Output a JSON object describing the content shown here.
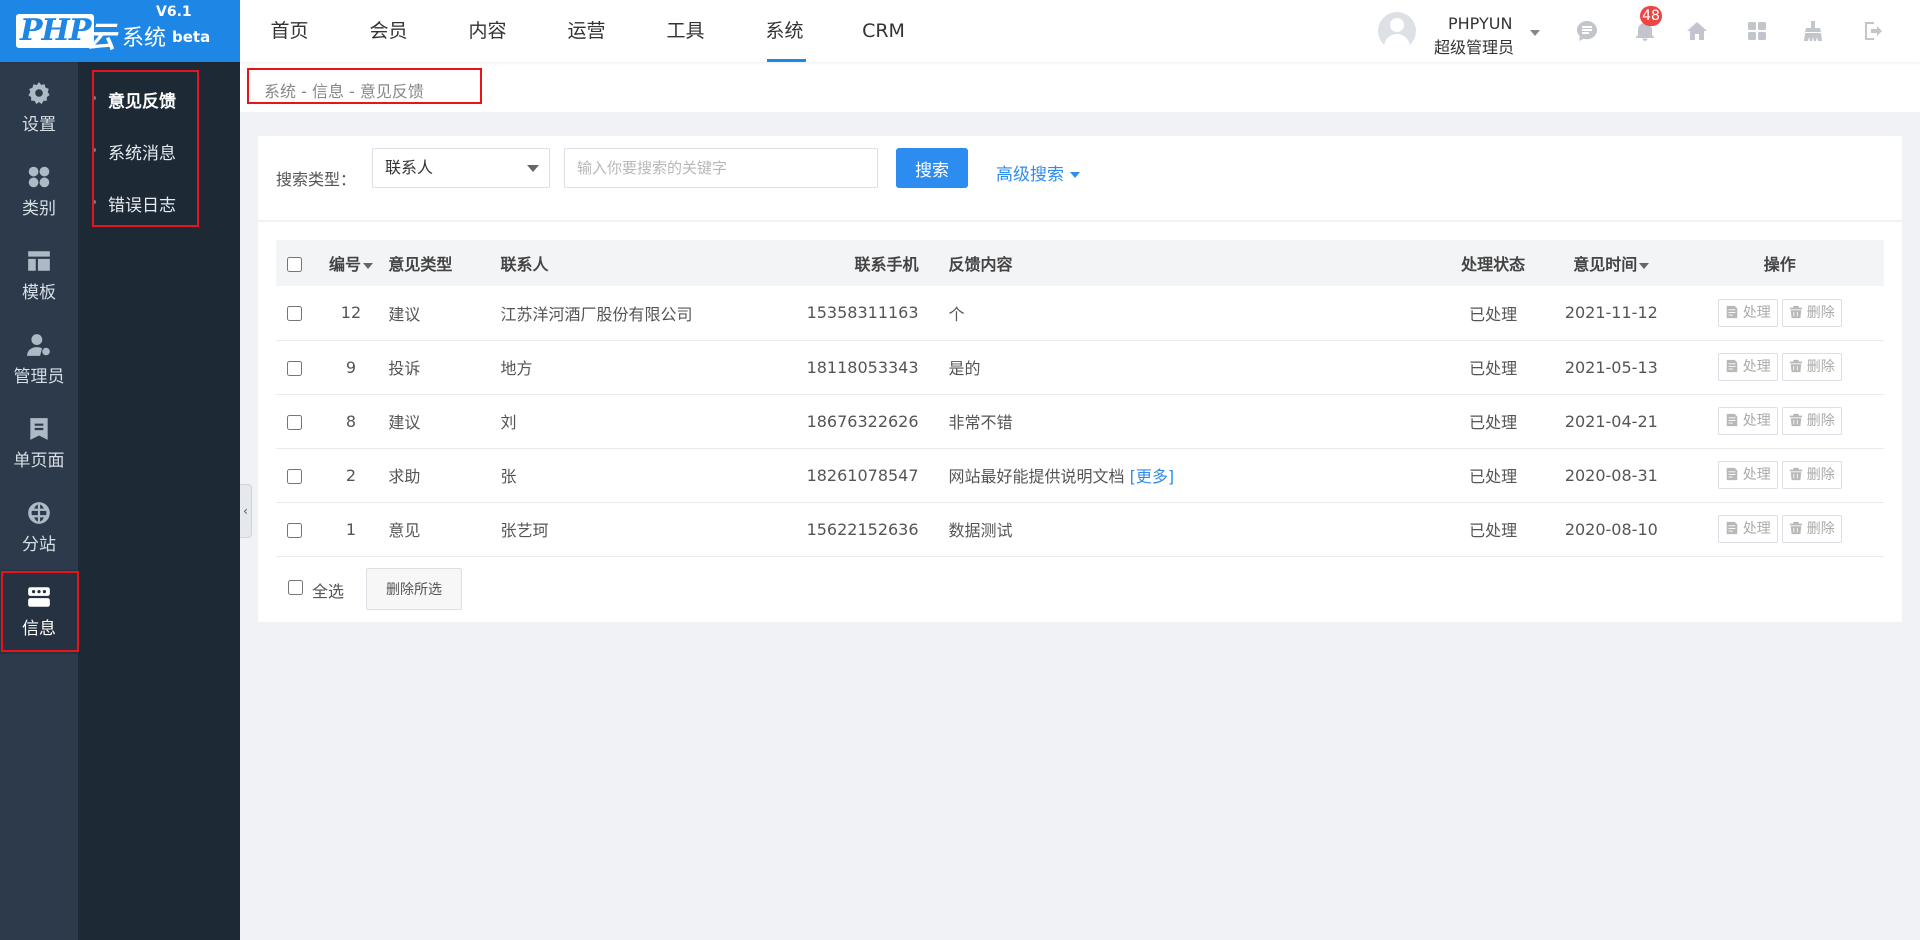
{
  "logo": {
    "php": "PHP",
    "yun": "云",
    "sys": "系统",
    "version": "V6.1",
    "beta": "beta"
  },
  "mainnav": [
    "首页",
    "会员",
    "内容",
    "运营",
    "工具",
    "系统",
    "CRM"
  ],
  "user": {
    "name": "PHPYUN",
    "role": "超级管理员",
    "notification_count": "48"
  },
  "toolbar_icons": [
    "message-icon",
    "bell-icon",
    "home-icon",
    "apps-icon",
    "broom-icon",
    "logout-icon"
  ],
  "sidebar": [
    {
      "label": "设置",
      "icon": "gear-icon"
    },
    {
      "label": "类别",
      "icon": "category-icon"
    },
    {
      "label": "模板",
      "icon": "template-icon"
    },
    {
      "label": "管理员",
      "icon": "admin-icon"
    },
    {
      "label": "单页面",
      "icon": "page-icon"
    },
    {
      "label": "分站",
      "icon": "globe-icon"
    },
    {
      "label": "信息",
      "icon": "info-icon",
      "active": true
    }
  ],
  "subnav": [
    "意见反馈",
    "系统消息",
    "错误日志"
  ],
  "breadcrumb": "系统 - 信息 - 意见反馈",
  "search": {
    "label": "搜索类型：",
    "type_value": "联系人",
    "placeholder": "输入你要搜索的关键字",
    "button": "搜索",
    "advanced": "高级搜索"
  },
  "table": {
    "headers": [
      "编号",
      "意见类型",
      "联系人",
      "联系手机",
      "反馈内容",
      "处理状态",
      "意见时间",
      "操作"
    ],
    "rows": [
      {
        "id": "12",
        "type": "建议",
        "contact": "江苏洋河酒厂股份有限公司",
        "phone": "15358311163",
        "content": "个",
        "more": "",
        "status": "已处理",
        "time": "2021-11-12"
      },
      {
        "id": "9",
        "type": "投诉",
        "contact": "地方",
        "phone": "18118053343",
        "content": "是的",
        "more": "",
        "status": "已处理",
        "time": "2021-05-13"
      },
      {
        "id": "8",
        "type": "建议",
        "contact": "刘",
        "phone": "18676322626",
        "content": "非常不错",
        "more": "",
        "status": "已处理",
        "time": "2021-04-21"
      },
      {
        "id": "2",
        "type": "求助",
        "contact": "张",
        "phone": "18261078547",
        "content": "网站最好能提供说明文档",
        "more": "[更多]",
        "status": "已处理",
        "time": "2020-08-31"
      },
      {
        "id": "1",
        "type": "意见",
        "contact": "张艺珂",
        "phone": "15622152636",
        "content": "数据测试",
        "more": "",
        "status": "已处理",
        "time": "2020-08-10"
      }
    ],
    "op_process": "处理",
    "op_delete": "删除"
  },
  "footer": {
    "select_all": "全选",
    "delete_selected": "删除所选"
  },
  "colors": {
    "brand": "#1e87e5",
    "sidebar": "#2c3a4b",
    "subnav": "#1e2936",
    "highlight": "#e8141a"
  }
}
